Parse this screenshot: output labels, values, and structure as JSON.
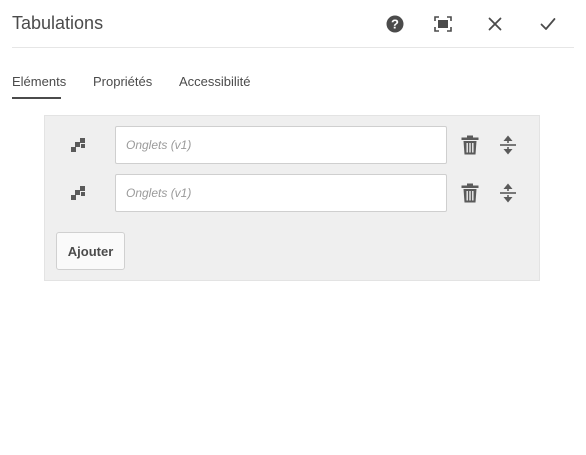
{
  "dialog": {
    "title": "Tabulations",
    "actions": [
      {
        "name": "help-icon"
      },
      {
        "name": "fullscreen-icon"
      },
      {
        "name": "close-icon"
      },
      {
        "name": "checkmark-icon"
      }
    ]
  },
  "tabs": [
    {
      "label": "Eléments",
      "active": true
    },
    {
      "label": "Propriétés",
      "active": false
    },
    {
      "label": "Accessibilité",
      "active": false
    }
  ],
  "items": [
    {
      "value": "",
      "placeholder": "Onglets (v1)"
    },
    {
      "value": "",
      "placeholder": "Onglets (v1)"
    }
  ],
  "add_button_label": "Ajouter",
  "colors": {
    "text": "#4b4b4b",
    "panel_bg": "#efefef",
    "icon": "#5a5a5a"
  }
}
